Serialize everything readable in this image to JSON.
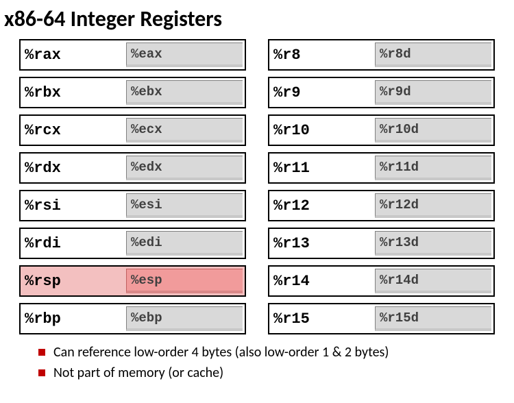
{
  "title": "x86-64 Integer Registers",
  "left": [
    {
      "r64": "%rax",
      "r32": "%eax",
      "hl": false
    },
    {
      "r64": "%rbx",
      "r32": "%ebx",
      "hl": false
    },
    {
      "r64": "%rcx",
      "r32": "%ecx",
      "hl": false
    },
    {
      "r64": "%rdx",
      "r32": "%edx",
      "hl": false
    },
    {
      "r64": "%rsi",
      "r32": "%esi",
      "hl": false
    },
    {
      "r64": "%rdi",
      "r32": "%edi",
      "hl": false
    },
    {
      "r64": "%rsp",
      "r32": "%esp",
      "hl": true
    },
    {
      "r64": "%rbp",
      "r32": "%ebp",
      "hl": false
    }
  ],
  "right": [
    {
      "r64": "%r8",
      "r32": "%r8d",
      "hl": false
    },
    {
      "r64": "%r9",
      "r32": "%r9d",
      "hl": false
    },
    {
      "r64": "%r10",
      "r32": "%r10d",
      "hl": false
    },
    {
      "r64": "%r11",
      "r32": "%r11d",
      "hl": false
    },
    {
      "r64": "%r12",
      "r32": "%r12d",
      "hl": false
    },
    {
      "r64": "%r13",
      "r32": "%r13d",
      "hl": false
    },
    {
      "r64": "%r14",
      "r32": "%r14d",
      "hl": false
    },
    {
      "r64": "%r15",
      "r32": "%r15d",
      "hl": false
    }
  ],
  "bullets": [
    "Can reference low-order 4 bytes (also low-order 1 & 2 bytes)",
    "Not part of memory (or cache)"
  ]
}
